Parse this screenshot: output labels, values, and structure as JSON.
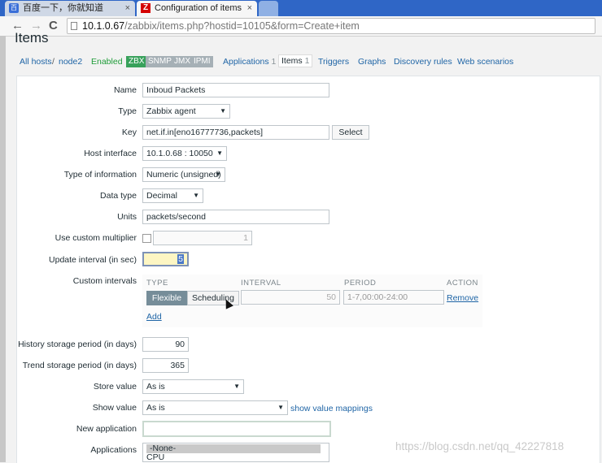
{
  "browser": {
    "tabs": [
      {
        "title": "百度一下，你就知道",
        "close": "×"
      },
      {
        "title": "Configuration of items",
        "close": "×"
      }
    ],
    "url_host": "10.1.0.67",
    "url_path": "/zabbix/items.php?hostid=10105&form=Create+item",
    "nav": {
      "back": "←",
      "forward": "→",
      "reload": "C"
    }
  },
  "page": {
    "title": "Items"
  },
  "breadcrumb": {
    "all_hosts": "All hosts",
    "sep": "/",
    "host": "node2",
    "status": "Enabled",
    "badges": [
      "ZBX",
      "SNMP",
      "JMX",
      "IPMI"
    ],
    "applications": "Applications",
    "applications_count": "1",
    "items": "Items",
    "items_count": "1",
    "triggers": "Triggers",
    "graphs": "Graphs",
    "discovery": "Discovery rules",
    "web": "Web scenarios"
  },
  "form": {
    "name": {
      "label": "Name",
      "value": "Inboud Packets"
    },
    "type": {
      "label": "Type",
      "value": "Zabbix agent"
    },
    "key": {
      "label": "Key",
      "value": "net.if.in[eno16777736,packets]",
      "button": "Select"
    },
    "host_interface": {
      "label": "Host interface",
      "value": "10.1.0.68 : 10050"
    },
    "type_of_information": {
      "label": "Type of information",
      "value": "Numeric (unsigned)"
    },
    "data_type": {
      "label": "Data type",
      "value": "Decimal"
    },
    "units": {
      "label": "Units",
      "value": "packets/second"
    },
    "multiplier": {
      "label": "Use custom multiplier",
      "value": "1",
      "checked": false
    },
    "update_interval": {
      "label": "Update interval (in sec)",
      "value": "5"
    },
    "custom_intervals": {
      "label": "Custom intervals",
      "headers": {
        "type": "TYPE",
        "interval": "INTERVAL",
        "period": "PERIOD",
        "action": "ACTION"
      },
      "types": [
        "Flexible",
        "Scheduling"
      ],
      "selected_type": "Flexible",
      "interval_value": "50",
      "period_placeholder": "1-7,00:00-24:00",
      "remove": "Remove",
      "add": "Add"
    },
    "history": {
      "label": "History storage period (in days)",
      "value": "90"
    },
    "trend": {
      "label": "Trend storage period (in days)",
      "value": "365"
    },
    "store_value": {
      "label": "Store value",
      "value": "As is"
    },
    "show_value": {
      "label": "Show value",
      "value": "As is",
      "link": "show value mappings"
    },
    "new_application": {
      "label": "New application",
      "value": ""
    },
    "applications": {
      "label": "Applications",
      "options": [
        "-None-",
        "CPU"
      ],
      "selected": "-None-"
    }
  },
  "watermark": "https://blog.csdn.net/qq_42227818",
  "colors": {
    "tabbar": "#2f66c6",
    "link": "#1f65a6",
    "enabled": "#1e9c38",
    "zbx_badge": "#38a15b",
    "focus": "#fdf6c3"
  }
}
